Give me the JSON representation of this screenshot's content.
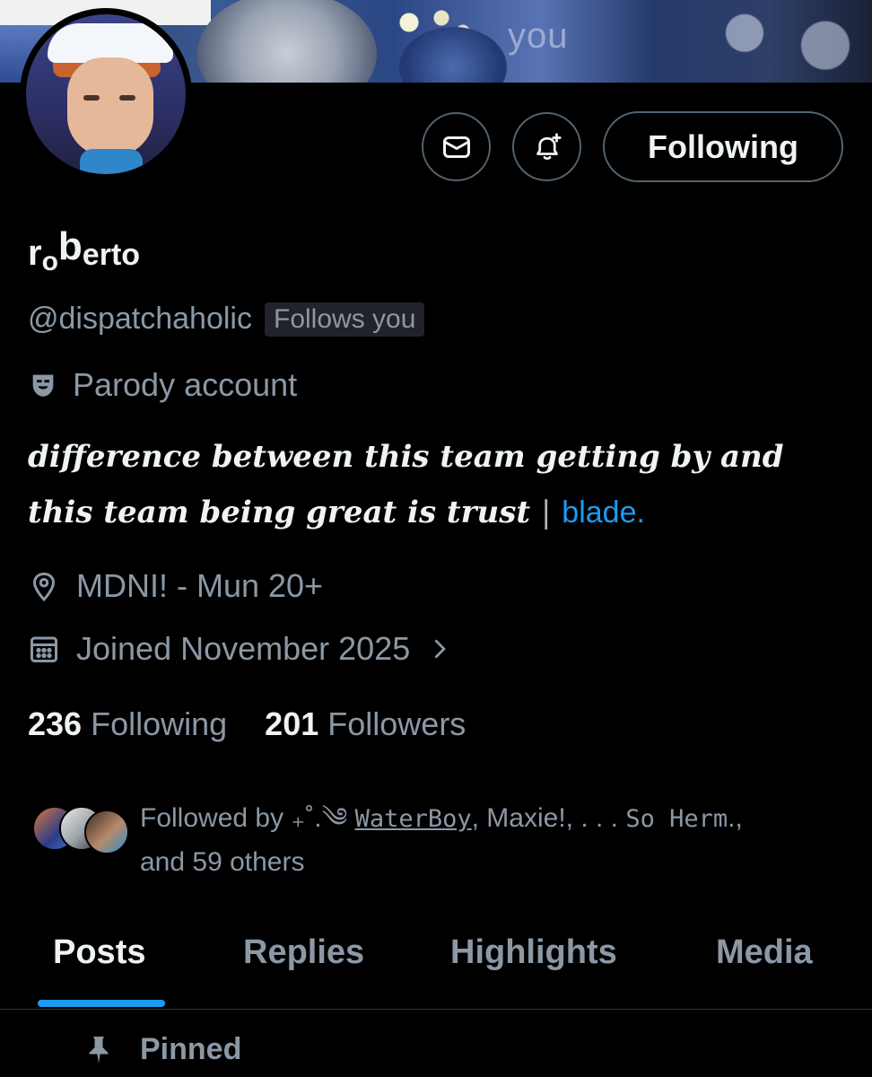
{
  "banner": {
    "word": "you"
  },
  "actions": {
    "message_icon": "envelope-icon",
    "notify_icon": "bell-plus-icon",
    "follow_label": "Following"
  },
  "profile": {
    "display_name_parts": [
      "r",
      "o",
      "b",
      "erto"
    ],
    "handle": "@dispatchaholic",
    "follows_you": "Follows you",
    "parody_label": "Parody account",
    "bio_text": "difference between this team getting by and this team being great is trust",
    "bio_separator": "|",
    "bio_link": "blade.",
    "location": "MDNI! - Mun 20+",
    "joined": "Joined November 2025"
  },
  "stats": {
    "following_count": "236",
    "following_label": "Following",
    "followers_count": "201",
    "followers_label": "Followers"
  },
  "followed_by": {
    "prefix": "Followed by ",
    "symbols": "₊˚.༄ ",
    "user1": "WaterBoy",
    "middle": ", Maxie!, . . . ",
    "user3": "So Herm",
    "suffix": "., and 59 others"
  },
  "tabs": [
    "Posts",
    "Replies",
    "Highlights",
    "Media"
  ],
  "active_tab": "Posts",
  "pinned_label": "Pinned",
  "colors": {
    "accent": "#1d9bf0",
    "background": "#000000",
    "muted": "#8b98a5"
  }
}
